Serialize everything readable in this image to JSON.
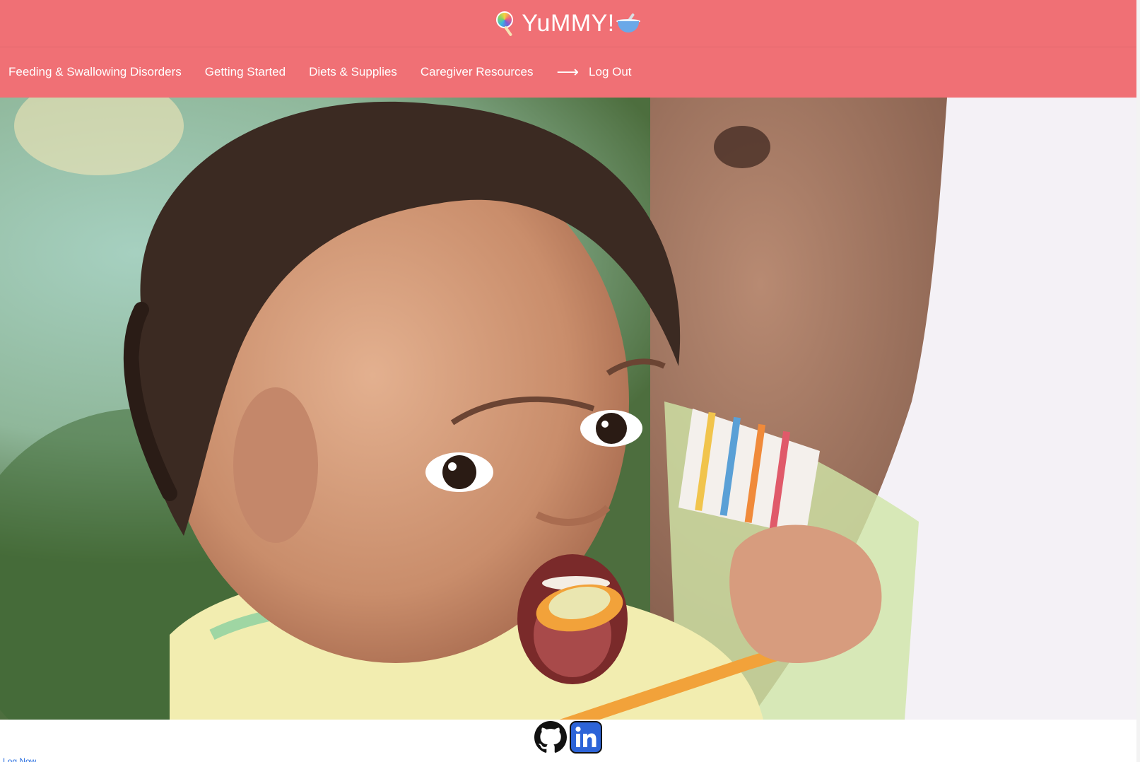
{
  "header": {
    "title": "YuMMY!",
    "left_icon": "lollipop-icon",
    "right_icon": "bowl-with-spoon-icon",
    "background_color": "#f07075"
  },
  "nav": {
    "items": [
      {
        "label": "Feeding & Swallowing Disorders"
      },
      {
        "label": "Getting Started"
      },
      {
        "label": "Diets & Supplies"
      },
      {
        "label": "Caregiver Resources"
      }
    ],
    "logout": {
      "icon": "arrow-right-icon",
      "arrow": "⟶",
      "label": "Log Out"
    }
  },
  "hero": {
    "image": "child-being-spoon-fed-photo"
  },
  "footer": {
    "icons": [
      "github-icon",
      "linkedin-icon"
    ],
    "link_text": "Log Now"
  }
}
